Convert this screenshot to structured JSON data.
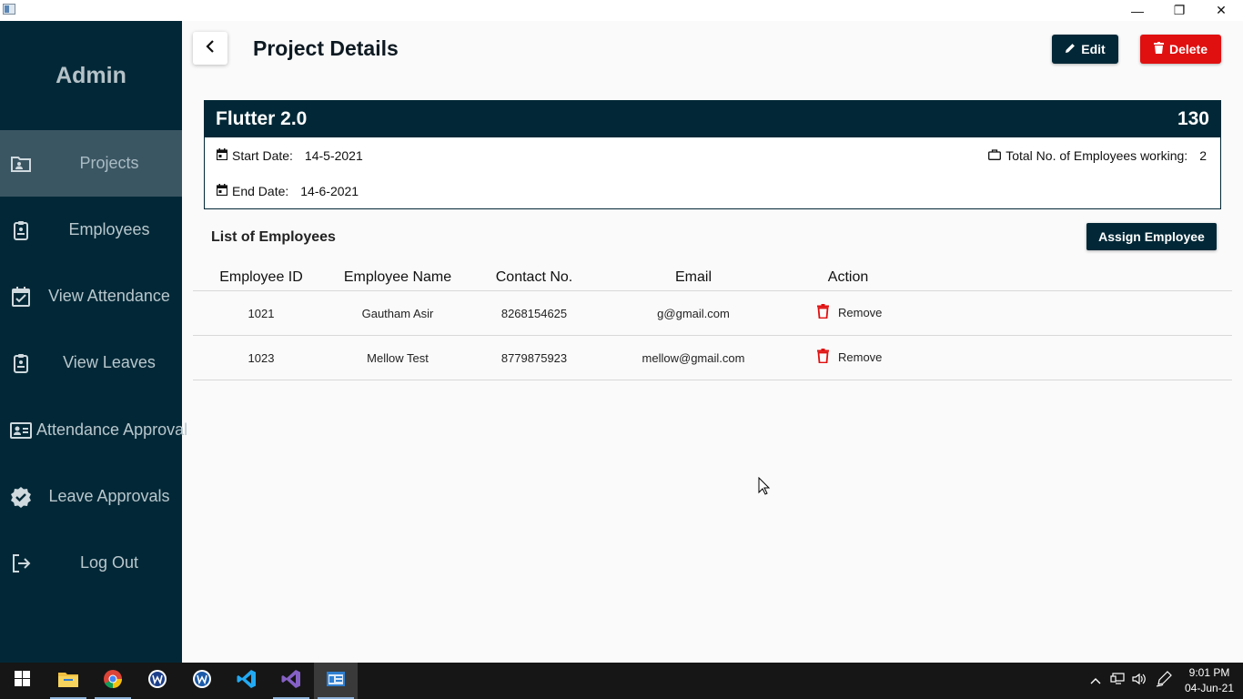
{
  "window": {
    "minimize_glyph": "—",
    "maximize_glyph": "❐",
    "close_glyph": "✕"
  },
  "sidebar": {
    "brand": "Admin",
    "items": [
      {
        "label": "Projects",
        "icon": "folder-user-icon",
        "active": true
      },
      {
        "label": "Employees",
        "icon": "id-badge-icon",
        "active": false
      },
      {
        "label": "View Attendance",
        "icon": "calendar-check-icon",
        "active": false
      },
      {
        "label": "View Leaves",
        "icon": "clipboard-icon",
        "active": false
      },
      {
        "label": "Attendance Approval",
        "icon": "id-card-icon",
        "active": false
      },
      {
        "label": "Leave Approvals",
        "icon": "verified-badge-icon",
        "active": false
      },
      {
        "label": "Log Out",
        "icon": "logout-icon",
        "active": false
      }
    ]
  },
  "header": {
    "title": "Project Details",
    "edit_label": "Edit",
    "delete_label": "Delete"
  },
  "project": {
    "name": "Flutter 2.0",
    "id": "130",
    "start_label": "Start Date:",
    "start_date": "14-5-2021",
    "end_label": "End Date:",
    "end_date": "14-6-2021",
    "total_label": "Total No. of Employees working:",
    "total_value": "2"
  },
  "employees": {
    "title": "List of Employees",
    "assign_label": "Assign Employee",
    "columns": [
      "Employee ID",
      "Employee Name",
      "Contact No.",
      "Email",
      "Action"
    ],
    "rows": [
      {
        "id": "1021",
        "name": "Gautham Asir",
        "contact": "8268154625",
        "email": "g@gmail.com",
        "action": "Remove"
      },
      {
        "id": "1023",
        "name": "Mellow Test",
        "contact": "8779875923",
        "email": "mellow@gmail.com",
        "action": "Remove"
      }
    ]
  },
  "taskbar": {
    "apps": [
      "windows-start",
      "file-explorer",
      "chrome",
      "app-w-1",
      "app-w-2",
      "vscode",
      "visual-studio",
      "flutter-app"
    ],
    "time": "9:01 PM",
    "date": "04-Jun-21"
  },
  "colors": {
    "primary": "#022837",
    "danger": "#e01010",
    "sidebar_active": "#3b5663"
  }
}
